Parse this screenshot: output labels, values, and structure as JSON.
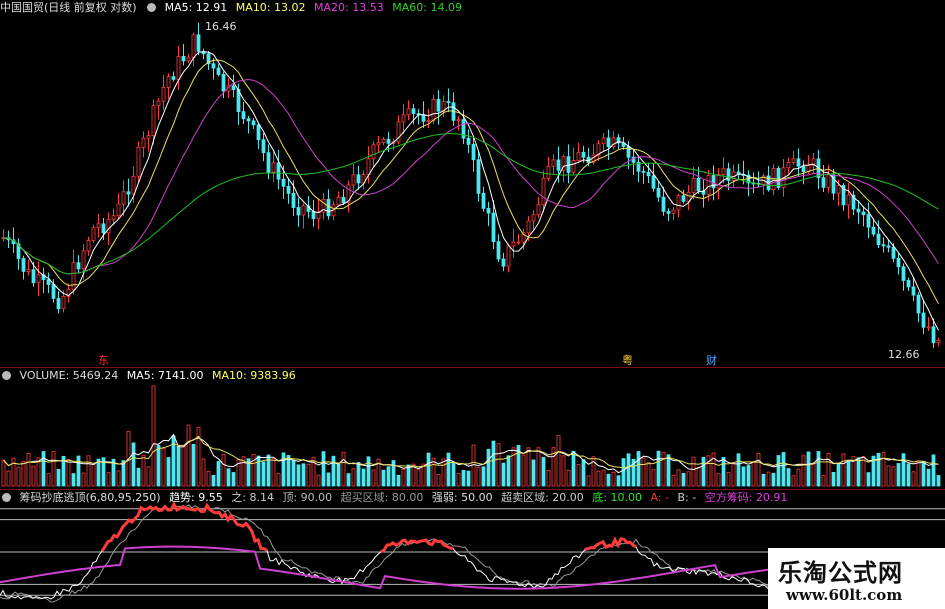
{
  "main_header": {
    "title": "中国国贸(日线 前复权 对数)",
    "ma5": "MA5: 12.91",
    "ma10": "MA10: 13.02",
    "ma20": "MA20: 13.53",
    "ma60": "MA60: 14.09"
  },
  "main_marks": {
    "high_label": "16.46",
    "low_label": "12.66",
    "mark1": "东",
    "mark2": "粤",
    "mark3": "财"
  },
  "volume_header": {
    "volume": "VOLUME: 5469.24",
    "ma5": "MA5: 7141.00",
    "ma10": "MA10: 9383.96"
  },
  "indicator_header": {
    "name": "筹码抄底逃顶(6,80,95,250)",
    "trend": "趋势: 9.55",
    "zhi": "之: 8.14",
    "ding": "顶: 90.00",
    "overbuy": "超买区域: 80.00",
    "strong_weak": "强弱: 50.00",
    "oversell": "超卖区域: 20.00",
    "di": "底: 10.00",
    "a": "A: -",
    "b": "B: -",
    "short_chips": "空方筹码: 20.91"
  },
  "watermark": {
    "title": "乐淘公式网",
    "url": "www.60lt.com"
  },
  "colors": {
    "up": "#ff3b3b",
    "down": "#4ee7f0",
    "ma5": "#ffffff",
    "ma10": "#e8e060",
    "ma20": "#d040d0",
    "ma60": "#20c020",
    "hdr_yellow": "#ffff66"
  },
  "chart_data": {
    "type": "candlestick",
    "price_range": [
      12.66,
      16.46
    ],
    "indicator_levels": [
      10,
      20,
      50,
      80,
      90
    ]
  }
}
